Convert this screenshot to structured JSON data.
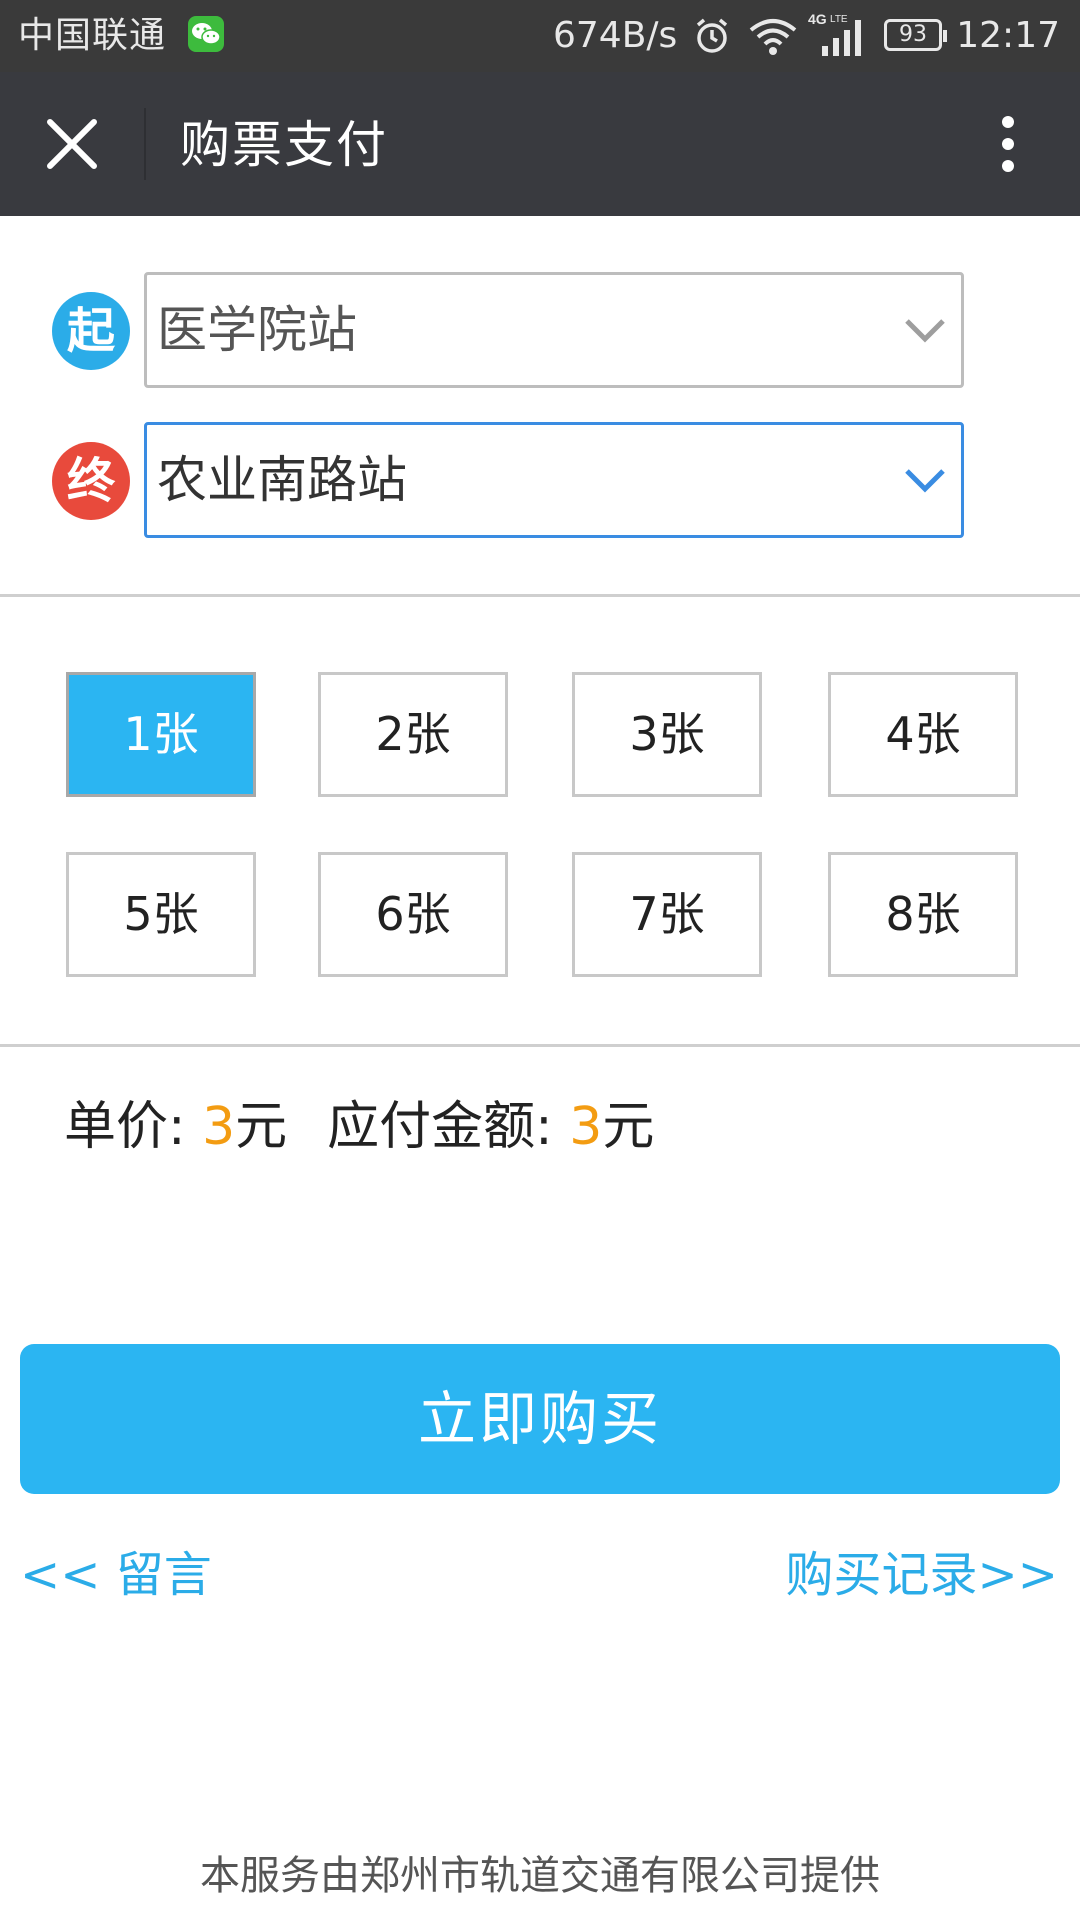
{
  "status_bar": {
    "carrier": "中国联通",
    "speed": "674B/s",
    "network": "4G LTE",
    "battery": "93",
    "time": "12:17"
  },
  "header": {
    "title": "购票支付",
    "close_icon": "close-icon",
    "more_icon": "more-vertical-icon"
  },
  "route": {
    "start_badge": "起",
    "start_station": "医学院站",
    "end_badge": "终",
    "end_station": "农业南路站"
  },
  "quantity": {
    "selected": "1张",
    "options": [
      "1张",
      "2张",
      "3张",
      "4张",
      "5张",
      "6张",
      "7张",
      "8张"
    ]
  },
  "price": {
    "unit_label": "单价: ",
    "unit_value": "3",
    "unit_suffix": "元",
    "total_label": "应付金额: ",
    "total_value": "3",
    "total_suffix": "元"
  },
  "actions": {
    "buy_label": "立即购买",
    "message_link": "<< 留言",
    "history_link": "购买记录>>"
  },
  "footer": {
    "text": "本服务由郑州市轨道交通有限公司提供"
  },
  "colors": {
    "accent": "#2bb5f2",
    "start_badge": "#2bace8",
    "end_badge": "#e84a3c",
    "price": "#f39c12",
    "header": "#393a3f"
  }
}
